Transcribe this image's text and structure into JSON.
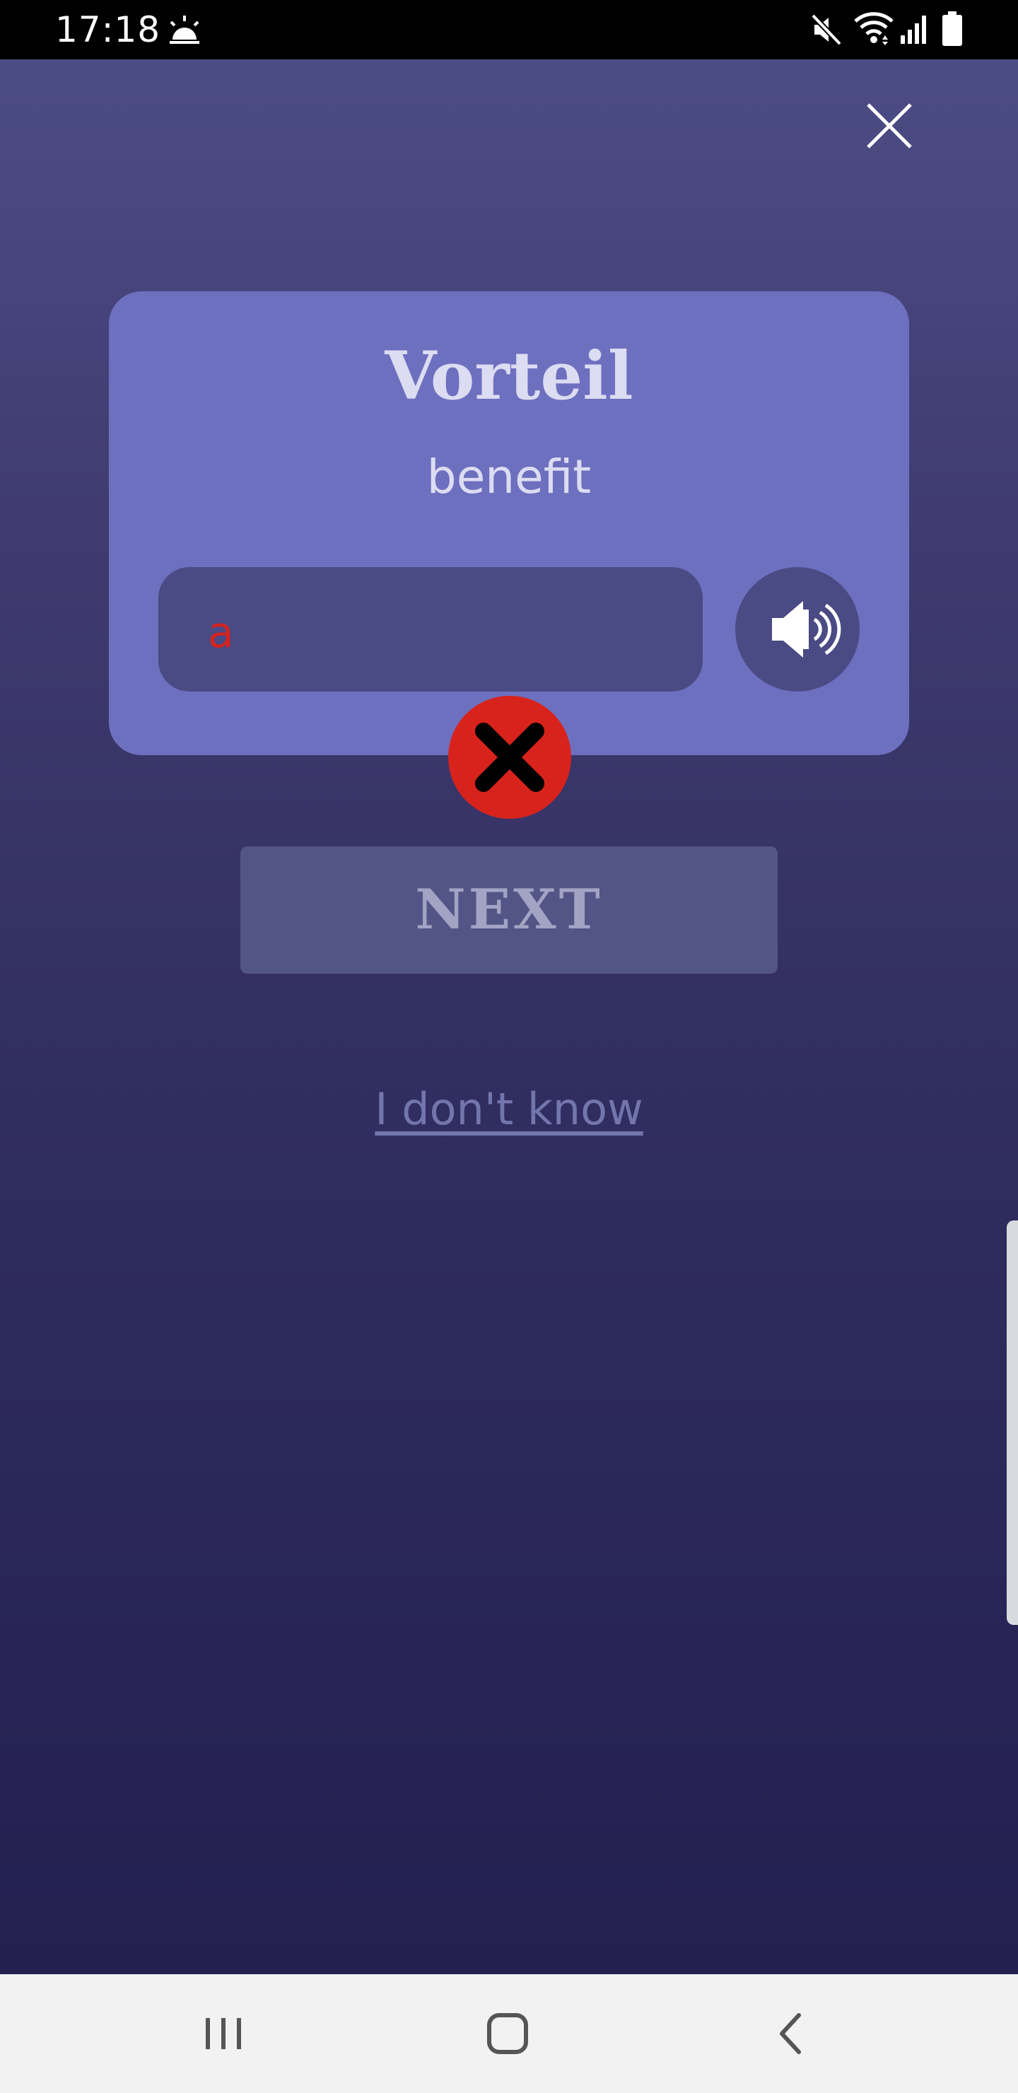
{
  "status_bar": {
    "time": "17:18",
    "icons": [
      "weather-sunrise-icon",
      "mute-icon",
      "wifi-icon",
      "signal-icon",
      "battery-icon"
    ]
  },
  "header": {
    "close_icon": "close-icon"
  },
  "card": {
    "word": "Vorteil",
    "translation": "benefit",
    "answer_value": "a",
    "speaker_icon": "speaker-icon"
  },
  "feedback": {
    "status": "incorrect",
    "icon": "x-icon"
  },
  "actions": {
    "next_label": "NEXT",
    "dont_know_label": "I don't know"
  },
  "nav_bar": {
    "icons": [
      "recent-apps-icon",
      "home-icon",
      "back-icon"
    ]
  },
  "colors": {
    "card_background": "#6d6fbf",
    "error": "#d8231c",
    "answer_text": "#d4241f",
    "next_button": "#535586"
  }
}
